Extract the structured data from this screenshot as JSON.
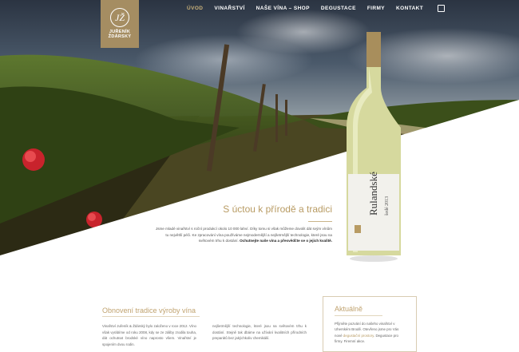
{
  "brand": {
    "monogram": "JŽ",
    "name_line1": "JUŘENÍK",
    "name_line2": "ŽDÁRSKÝ"
  },
  "nav": {
    "items": [
      {
        "label": "ÚVOD",
        "active": true
      },
      {
        "label": "VINAŘSTVÍ",
        "active": false
      },
      {
        "label": "NAŠE VÍNA – SHOP",
        "active": false
      },
      {
        "label": "DEGUSTACE",
        "active": false
      },
      {
        "label": "FIRMY",
        "active": false
      },
      {
        "label": "KONTAKT",
        "active": false
      }
    ]
  },
  "bottle": {
    "label_main": "Rulandské",
    "label_sub": "šedé 2013"
  },
  "hero": {
    "tagline": "S úctou k přírodě a tradici",
    "intro": "Jsme mladé vinařství s roční produkcí okolo 10 000 lahví. Díky tomu si však můžeme dovolit dát svým vínům tu největší péči. Ke zpracování vína používáme nejmodernější a nejšetrnější technologie, které jsou na světovém trhu k dostání.",
    "intro_link": "Ochutnejte naše vína a přesvědčte se o jejich kvalitě."
  },
  "section": {
    "title": "Obnovení tradice výroby vína",
    "col1": "Vinařství Juřeník & Ždárský bylo založeno v roce 2012. Víno však vyrábíme od roku 2008, kdy se ze záliby zrodila touha, dát ochutnat brodské víno naprosto všem. Vinařství je spojením dvou rodin.",
    "col2": "nejšetrnější technologie, které jsou na světovém trhu k dostání. Stejně tak dbáme na užívání kvalitních přírodních preparátů bez jakýchkoliv chemikálií."
  },
  "news": {
    "title": "Aktuálně",
    "text": "Přijměte pozvání do našeho vinařství v Uherském Brodě. Otevřeno jsme pro Vás nové ",
    "link": "degustační prostory",
    "text2": ". Degustace pro firmy. Firemní akce."
  },
  "colors": {
    "accent": "#a58d62",
    "gold_text": "#b89b63"
  }
}
